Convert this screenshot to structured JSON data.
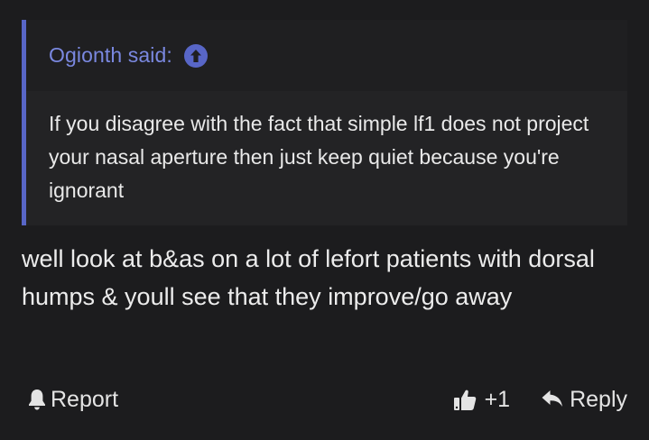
{
  "quote": {
    "author": "Ogionth said:",
    "text": "If you disagree with the fact that simple lf1 does not project your nasal aperture then just keep quiet because you're ignorant",
    "jump_icon": "arrow-up-circle-icon"
  },
  "post": {
    "text": "well look at b&as on a lot of lefort patients with dorsal humps & youll see that they improve/go away"
  },
  "footer": {
    "report_label": "Report",
    "like_count": "+1",
    "reply_label": "Reply"
  },
  "colors": {
    "background": "#1c1c1e",
    "quote_background": "#232325",
    "accent": "#5866c7",
    "author_link": "#7a88e0"
  }
}
